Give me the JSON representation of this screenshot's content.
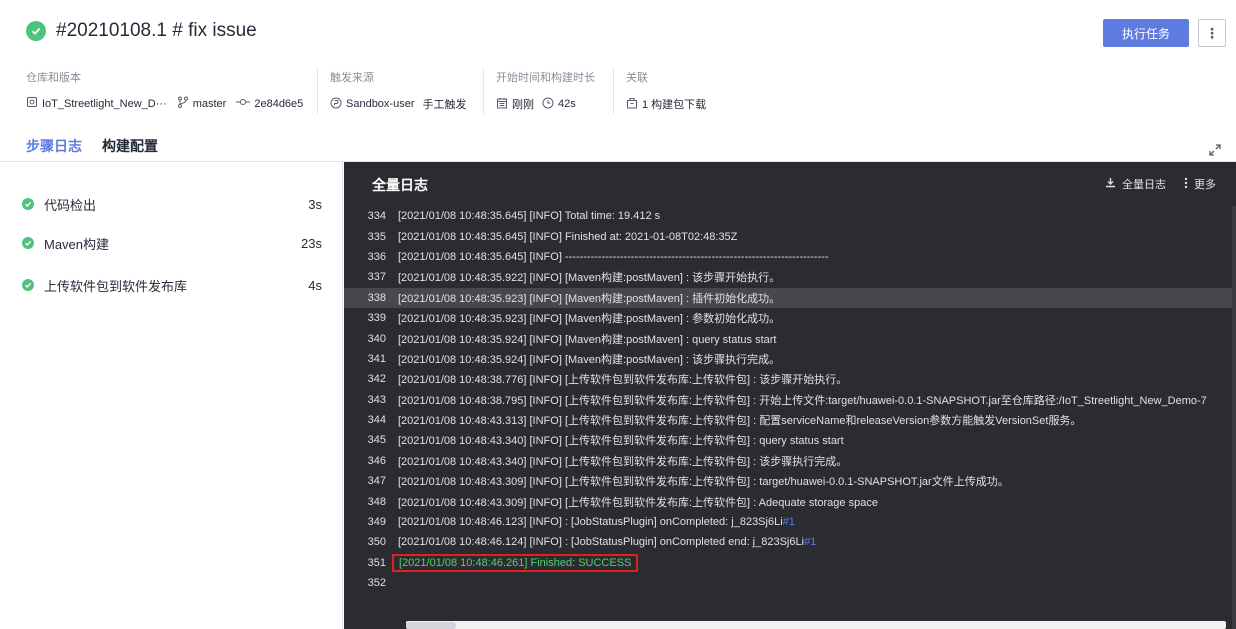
{
  "header": {
    "title": "#20210108.1  # fix issue",
    "run_button": "执行任务",
    "more_button": "⋮"
  },
  "meta": {
    "repo_label": "仓库和版本",
    "repo_name": "IoT_Streetlight_New_D···",
    "branch": "master",
    "commit": "2e84d6e5",
    "trigger_label": "触发来源",
    "trigger_user": "Sandbox-user",
    "trigger_type": "手工触发",
    "time_label": "开始时间和构建时长",
    "start_time": "刚刚",
    "duration": "42s",
    "related_label": "关联",
    "related_value": "1 构建包下载"
  },
  "tabs": [
    {
      "label": "步骤日志",
      "active": true
    },
    {
      "label": "构建配置",
      "active": false
    }
  ],
  "steps": [
    {
      "name": "代码检出",
      "duration": "3s"
    },
    {
      "name": "Maven构建",
      "duration": "23s"
    },
    {
      "name": "上传软件包到软件发布库",
      "duration": "4s"
    }
  ],
  "log": {
    "title": "全量日志",
    "download_label": "全量日志",
    "more_label": "更多",
    "lines": [
      {
        "n": "334",
        "t": "[2021/01/08 10:48:35.645] [INFO] Total time: 19.412 s"
      },
      {
        "n": "335",
        "t": "[2021/01/08 10:48:35.645] [INFO] Finished at: 2021-01-08T02:48:35Z"
      },
      {
        "n": "336",
        "t": "[2021/01/08 10:48:35.645] [INFO] ------------------------------------------------------------------------"
      },
      {
        "n": "337",
        "t": "[2021/01/08 10:48:35.922] [INFO] [Maven构建:postMaven] : 该步骤开始执行。"
      },
      {
        "n": "338",
        "t": "[2021/01/08 10:48:35.923] [INFO] [Maven构建:postMaven] : 插件初始化成功。"
      },
      {
        "n": "339",
        "t": "[2021/01/08 10:48:35.923] [INFO] [Maven构建:postMaven] : 参数初始化成功。"
      },
      {
        "n": "340",
        "t": "[2021/01/08 10:48:35.924] [INFO] [Maven构建:postMaven] : query status start"
      },
      {
        "n": "341",
        "t": "[2021/01/08 10:48:35.924] [INFO] [Maven构建:postMaven] : 该步骤执行完成。"
      },
      {
        "n": "342",
        "t": "[2021/01/08 10:48:38.776] [INFO] [上传软件包到软件发布库:上传软件包] : 该步骤开始执行。"
      },
      {
        "n": "343",
        "t": "[2021/01/08 10:48:38.795] [INFO] [上传软件包到软件发布库:上传软件包] : 开始上传文件:target/huawei-0.0.1-SNAPSHOT.jar至仓库路径:/IoT_Streetlight_New_Demo-7"
      },
      {
        "n": "344",
        "t": "[2021/01/08 10:48:43.313] [INFO] [上传软件包到软件发布库:上传软件包] : 配置serviceName和releaseVersion参数方能触发VersionSet服务。"
      },
      {
        "n": "345",
        "t": "[2021/01/08 10:48:43.340] [INFO] [上传软件包到软件发布库:上传软件包] : query status start"
      },
      {
        "n": "346",
        "t": "[2021/01/08 10:48:43.340] [INFO] [上传软件包到软件发布库:上传软件包] : 该步骤执行完成。"
      },
      {
        "n": "347",
        "t": "[2021/01/08 10:48:43.309] [INFO] [上传软件包到软件发布库:上传软件包] : target/huawei-0.0.1-SNAPSHOT.jar文件上传成功。"
      },
      {
        "n": "348",
        "t": "[2021/01/08 10:48:43.309] [INFO] [上传软件包到软件发布库:上传软件包] : Adequate storage space"
      },
      {
        "n": "349",
        "t": "[2021/01/08 10:48:46.123] [INFO]  : [JobStatusPlugin] onCompleted: j_823Sj6Li ",
        "link": "#1"
      },
      {
        "n": "350",
        "t": "[2021/01/08 10:48:46.124] [INFO]  : [JobStatusPlugin] onCompleted end: j_823Sj6Li ",
        "link": "#1"
      },
      {
        "n": "351",
        "t": "[2021/01/08 10:48:46.261] Finished: SUCCESS"
      },
      {
        "n": "352",
        "t": ""
      }
    ]
  }
}
